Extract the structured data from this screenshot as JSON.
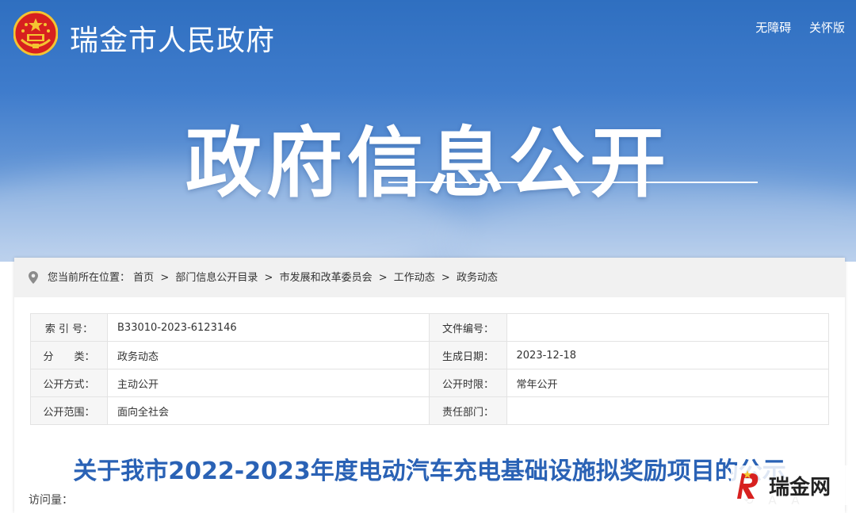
{
  "header": {
    "site_name": "瑞金市人民政府",
    "links": [
      "无障碍",
      "关怀版"
    ],
    "banner_title": "政府信息公开"
  },
  "breadcrumb": {
    "prefix": "您当前所在位置：",
    "items": [
      "首页",
      "部门信息公开目录",
      "市发展和改革委员会",
      "工作动态",
      "政务动态"
    ],
    "separator": ">"
  },
  "meta": {
    "rows": [
      {
        "l1": "索 引 号：",
        "v1": "B33010-2023-6123146",
        "l2": "文件编号：",
        "v2": ""
      },
      {
        "l1": "分　　类：",
        "v1": "政务动态",
        "l2": "生成日期：",
        "v2": "2023-12-18"
      },
      {
        "l1": "公开方式：",
        "v1": "主动公开",
        "l2": "公开时限：",
        "v2": "常年公开"
      },
      {
        "l1": "公开范围：",
        "v1": "面向全社会",
        "l2": "责任部门：",
        "v2": ""
      }
    ]
  },
  "article": {
    "title": "关于我市2022-2023年度电动汽车充电基础设施拟奖励项目的公示",
    "visits_label": "访问量：",
    "font_tools": [
      "A",
      "A"
    ]
  },
  "watermark": {
    "text": "瑞金网"
  },
  "colors": {
    "banner_top": "#2f6fc0",
    "title_blue": "#2a62b5",
    "emblem_red": "#d7201f",
    "emblem_gold": "#f4c431"
  }
}
